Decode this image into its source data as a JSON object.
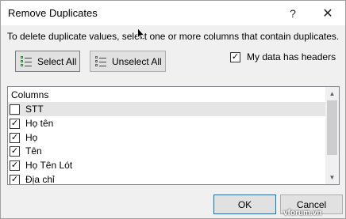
{
  "dialog": {
    "title": "Remove Duplicates",
    "help_glyph": "?",
    "close_glyph": "✕"
  },
  "instruction": "To delete duplicate values, select one or more columns that contain duplicates.",
  "buttons": {
    "select_all": "Select All",
    "unselect_all": "Unselect All",
    "ok": "OK",
    "cancel": "Cancel"
  },
  "headers_option": {
    "label": "My data has headers",
    "checked": true
  },
  "columns": {
    "heading": "Columns",
    "items": [
      {
        "label": "STT",
        "checked": false
      },
      {
        "label": "Họ tên",
        "checked": true
      },
      {
        "label": "Họ",
        "checked": true
      },
      {
        "label": "Tên",
        "checked": true
      },
      {
        "label": "Họ Tên Lót",
        "checked": true
      },
      {
        "label": "Địa chỉ",
        "checked": true
      }
    ]
  },
  "watermark": "vforum.vn"
}
